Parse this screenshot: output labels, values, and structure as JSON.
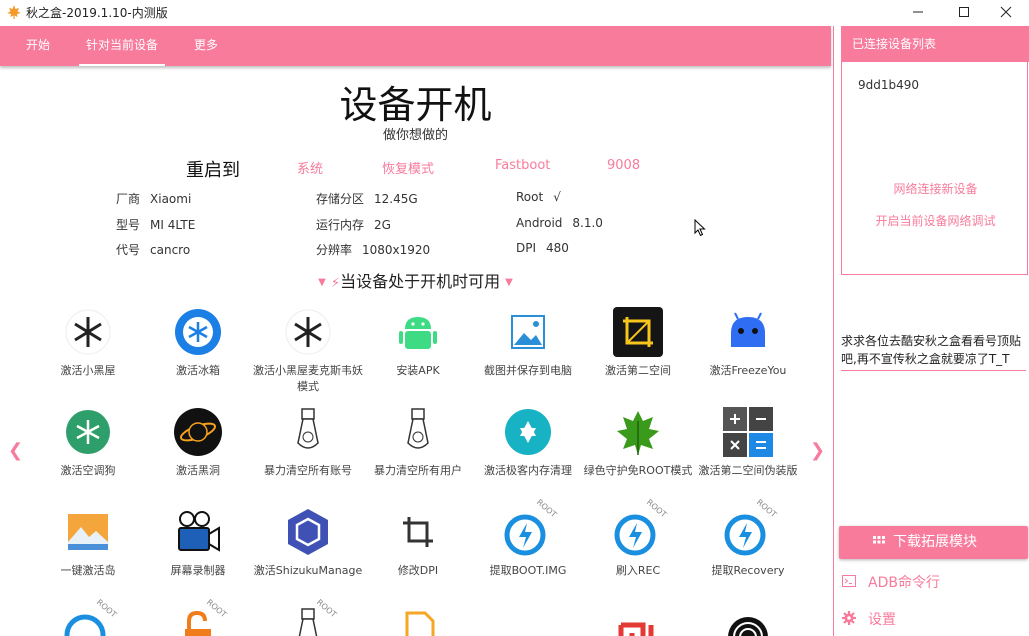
{
  "window": {
    "title": "秋之盒-2019.1.10-内测版"
  },
  "nav": {
    "tabs": [
      "开始",
      "针对当前设备",
      "更多"
    ]
  },
  "main": {
    "title": "设备开机",
    "subtitle": "做你想做的",
    "reboot": {
      "label": "重启到",
      "options": [
        "系统",
        "恢复模式",
        "Fastboot",
        "9008"
      ]
    },
    "info": [
      {
        "k": "厂商",
        "v": "Xiaomi"
      },
      {
        "k": "型号",
        "v": "MI 4LTE"
      },
      {
        "k": "代号",
        "v": "cancro"
      },
      {
        "k": "存储分区",
        "v": "12.45G"
      },
      {
        "k": "运行内存",
        "v": "2G"
      },
      {
        "k": "分辨率",
        "v": "1080x1920"
      },
      {
        "k": "Root",
        "v": "√"
      },
      {
        "k": "Android",
        "v": "8.1.0"
      },
      {
        "k": "DPI",
        "v": "480"
      }
    ],
    "section": "当设备处于开机时可用",
    "functions": [
      {
        "label": "激活小黑屋",
        "icon": "stop-snowflake-icon"
      },
      {
        "label": "激活冰箱",
        "icon": "ice-box-icon"
      },
      {
        "label": "激活小黑屋麦克斯韦妖模式",
        "icon": "stop-snowflake-icon"
      },
      {
        "label": "安装APK",
        "icon": "android-robot-icon"
      },
      {
        "label": "截图并保存到电脑",
        "icon": "image-icon"
      },
      {
        "label": "激活第二空间",
        "icon": "crop-icon"
      },
      {
        "label": "激活FreezeYou",
        "icon": "freezeyou-icon"
      },
      {
        "label": "激活空调狗",
        "icon": "snowflake-icon"
      },
      {
        "label": "激活黑洞",
        "icon": "black-hole-icon"
      },
      {
        "label": "暴力清空所有账号",
        "icon": "nuke-icon"
      },
      {
        "label": "暴力清空所有用户",
        "icon": "nuke-icon"
      },
      {
        "label": "激活极客内存清理",
        "icon": "star-of-david-icon"
      },
      {
        "label": "绿色守护免ROOT模式",
        "icon": "leaf-icon"
      },
      {
        "label": "激活第二空间伪装版",
        "icon": "calculator-icon"
      },
      {
        "label": "一键激活岛",
        "icon": "island-icon"
      },
      {
        "label": "屏幕录制器",
        "icon": "video-camera-icon"
      },
      {
        "label": "激活ShizukuManage",
        "icon": "shizuku-icon"
      },
      {
        "label": "修改DPI",
        "icon": "crop-icon"
      },
      {
        "label": "提取BOOT.IMG",
        "icon": "flash-root-icon"
      },
      {
        "label": "刷入REC",
        "icon": "flash-root-icon"
      },
      {
        "label": "提取Recovery",
        "icon": "flash-root-icon"
      }
    ],
    "badge_root": "ROOT"
  },
  "side": {
    "header": "已连接设备列表",
    "device": "9dd1b490",
    "links": [
      "网络连接新设备",
      "开启当前设备网络调试"
    ],
    "notice": "求求各位去酷安秋之盒看看号顶贴吧,再不宣传秋之盒就要凉了T_T",
    "download_btn": "下载拓展模块",
    "adb_link": "ADB命令行",
    "settings_link": "设置"
  },
  "colors": {
    "accent": "#f87b9c"
  }
}
